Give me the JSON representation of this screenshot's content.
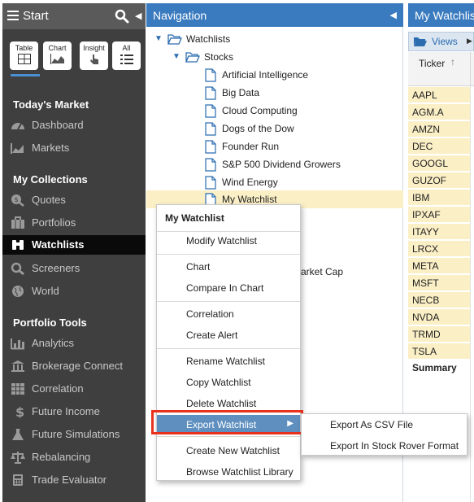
{
  "sidebar": {
    "title": "Start",
    "tiles": [
      {
        "label": "Table",
        "icon": "table-icon"
      },
      {
        "label": "Chart",
        "icon": "chart-icon"
      },
      {
        "label": "Insight",
        "icon": "insight-icon"
      },
      {
        "label": "All",
        "icon": "list-icon"
      }
    ],
    "sections": [
      {
        "title": "Today's Market"
      },
      {
        "title": "My Collections"
      },
      {
        "title": "Portfolio Tools"
      }
    ],
    "items": [
      {
        "label": "Dashboard",
        "icon": "dashboard-icon"
      },
      {
        "label": "Markets",
        "icon": "markets-chart-icon"
      },
      {
        "label": "Quotes",
        "icon": "quotes-search-icon"
      },
      {
        "label": "Portfolios",
        "icon": "briefcase-icon"
      },
      {
        "label": "Watchlists",
        "icon": "binoculars-icon"
      },
      {
        "label": "Screeners",
        "icon": "screener-search-icon"
      },
      {
        "label": "World",
        "icon": "globe-icon"
      },
      {
        "label": "Analytics",
        "icon": "bar-chart-icon"
      },
      {
        "label": "Brokerage Connect",
        "icon": "bank-icon"
      },
      {
        "label": "Correlation",
        "icon": "grid-icon"
      },
      {
        "label": "Future Income",
        "icon": "dollar-icon"
      },
      {
        "label": "Future Simulations",
        "icon": "flask-icon"
      },
      {
        "label": "Rebalancing",
        "icon": "scale-icon"
      },
      {
        "label": "Trade Evaluator",
        "icon": "calculator-icon"
      }
    ]
  },
  "navigation": {
    "title": "Navigation",
    "tree": [
      {
        "label": "Watchlists",
        "type": "folder"
      },
      {
        "label": "Stocks",
        "type": "folder"
      },
      {
        "label": "Artificial Intelligence",
        "type": "file"
      },
      {
        "label": "Big Data",
        "type": "file"
      },
      {
        "label": "Cloud Computing",
        "type": "file"
      },
      {
        "label": "Dogs of the Dow",
        "type": "file"
      },
      {
        "label": "Founder Run",
        "type": "file"
      },
      {
        "label": "S&P 500 Dividend Growers",
        "type": "file"
      },
      {
        "label": "Wind Energy",
        "type": "file"
      },
      {
        "label": "My Watchlist",
        "type": "file"
      }
    ],
    "obscured_fragment": "arket Cap"
  },
  "right_panel": {
    "title": "My Watchlis",
    "views_label": "Views",
    "column_header": "Ticker",
    "tickers": [
      "AAPL",
      "AGM.A",
      "AMZN",
      "DEC",
      "GOOGL",
      "GUZOF",
      "IBM",
      "IPXAF",
      "ITAYY",
      "LRCX",
      "META",
      "MSFT",
      "NECB",
      "NVDA",
      "TRMD",
      "TSLA"
    ],
    "summary_label": "Summary"
  },
  "context_menu": {
    "header": "My Watchlist",
    "items": [
      "Modify Watchlist",
      "Chart",
      "Compare In Chart",
      "Correlation",
      "Create Alert",
      "Rename Watchlist",
      "Copy Watchlist",
      "Delete Watchlist",
      "Export Watchlist",
      "Create New Watchlist",
      "Browse Watchlist Library"
    ],
    "submenu": [
      "Export As CSV File",
      "Export In Stock Rover Format"
    ]
  },
  "colors": {
    "sidebar_bg": "#3f3f3f",
    "header_blue": "#3a7bbf",
    "selection_yellow": "#fbefc6",
    "menu_highlight": "#5f8fbf",
    "focus_outline": "#e8321e"
  }
}
